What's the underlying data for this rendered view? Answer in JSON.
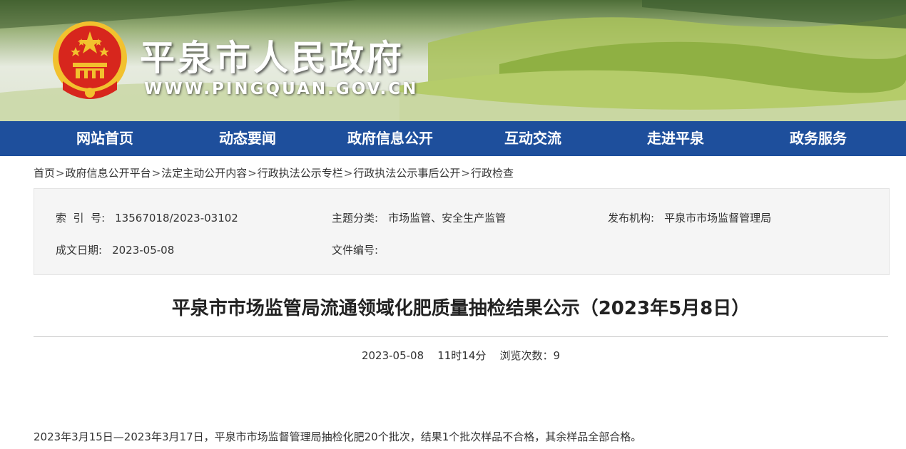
{
  "header": {
    "site_title": "平泉市人民政府",
    "site_domain": "WWW.PINGQUAN.GOV.CN",
    "emblem_icon": "national-emblem-icon",
    "colors": {
      "emblem_red": "#d7261d",
      "emblem_gold": "#f2c12e"
    }
  },
  "nav": {
    "background": "#1e4f9c",
    "items": [
      {
        "label": "网站首页"
      },
      {
        "label": "动态要闻"
      },
      {
        "label": "政府信息公开"
      },
      {
        "label": "互动交流"
      },
      {
        "label": "走进平泉"
      },
      {
        "label": "政务服务"
      }
    ]
  },
  "breadcrumb": {
    "separator": ">",
    "items": [
      {
        "label": "首页"
      },
      {
        "label": "政府信息公开平台"
      },
      {
        "label": "法定主动公开内容"
      },
      {
        "label": "行政执法公示专栏"
      },
      {
        "label": "行政执法公示事后公开"
      },
      {
        "label": "行政检查"
      }
    ]
  },
  "meta": {
    "index_no": {
      "label": "索  引  号:",
      "value": "13567018/2023-03102"
    },
    "topic": {
      "label": "主题分类:",
      "value": "市场监管、安全生产监管"
    },
    "publisher": {
      "label": "发布机构:",
      "value": "平泉市市场监督管理局"
    },
    "date": {
      "label": "成文日期:",
      "value": "2023-05-08"
    },
    "doc_no": {
      "label": "文件编号:",
      "value": ""
    }
  },
  "article": {
    "title": "平泉市市场监管局流通领域化肥质量抽检结果公示（2023年5月8日）",
    "publish_date": "2023-05-08",
    "publish_time": "11时14分",
    "views_label": "浏览次数：",
    "views": "9",
    "paragraph_1": "2023年3月15日—2023年3月17日，平泉市市场监督管理局抽检化肥20个批次，结果1个批次样品不合格，其余样品全部合格。"
  }
}
